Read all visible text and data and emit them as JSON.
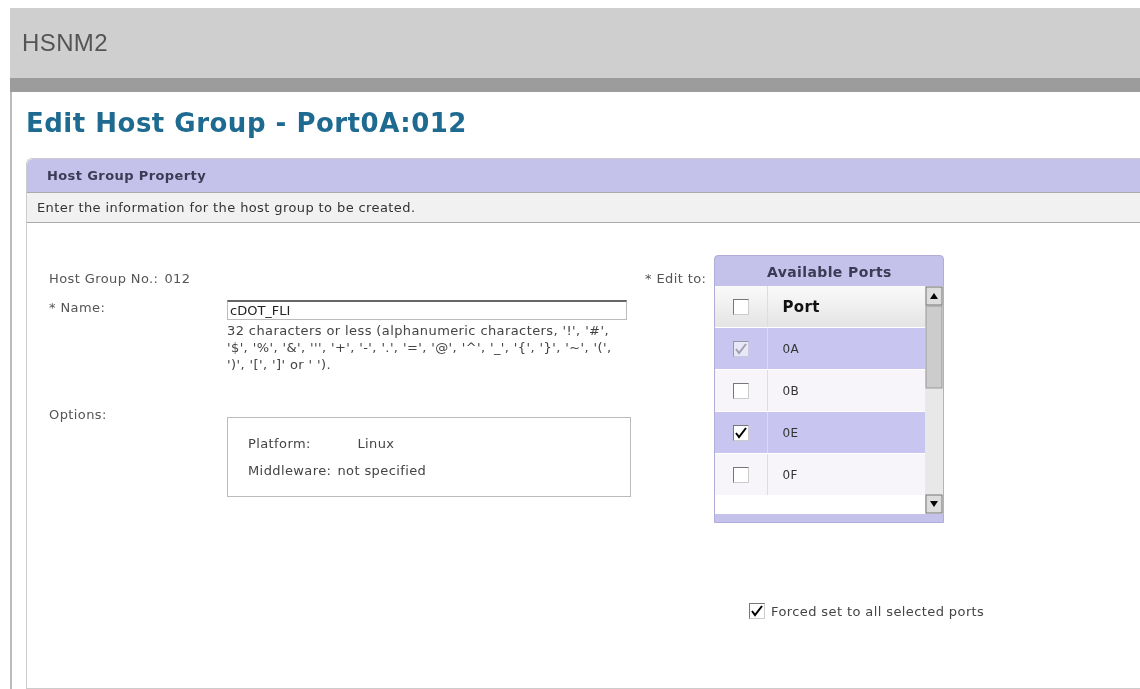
{
  "app_title": "HSNM2",
  "page_title": "Edit Host Group - Port0A:012",
  "panel": {
    "title": "Host Group Property",
    "instruction": "Enter the information for the host group to be created.",
    "host_group_no": {
      "label": "Host Group No.:",
      "value": "012"
    },
    "name": {
      "label": "* Name:",
      "value": "cDOT_FLI",
      "hint": "32 characters or less (alphanumeric characters, '!', '#', '$', '%', '&', ''', '+', '-', '.', '=', '@', '^', '_', '{', '}', '~', '(', ')', '[', ']' or ' ')."
    },
    "options": {
      "label": "Options:",
      "items": [
        {
          "label": "Platform:",
          "value": "Linux"
        },
        {
          "label": "Middleware:",
          "value": "not specified"
        }
      ]
    },
    "edit_to": {
      "label": "* Edit to:",
      "table_title": "Available Ports",
      "header": {
        "label": "Port",
        "checked": false
      },
      "rows": [
        {
          "label": "0A",
          "checked": true,
          "disabled": true,
          "selected": true
        },
        {
          "label": "0B",
          "checked": false,
          "disabled": false,
          "selected": false
        },
        {
          "label": "0E",
          "checked": true,
          "disabled": false,
          "selected": true
        },
        {
          "label": "0F",
          "checked": false,
          "disabled": false,
          "selected": false
        }
      ]
    },
    "forced": {
      "label": "Forced set to all selected ports",
      "checked": true
    }
  }
}
